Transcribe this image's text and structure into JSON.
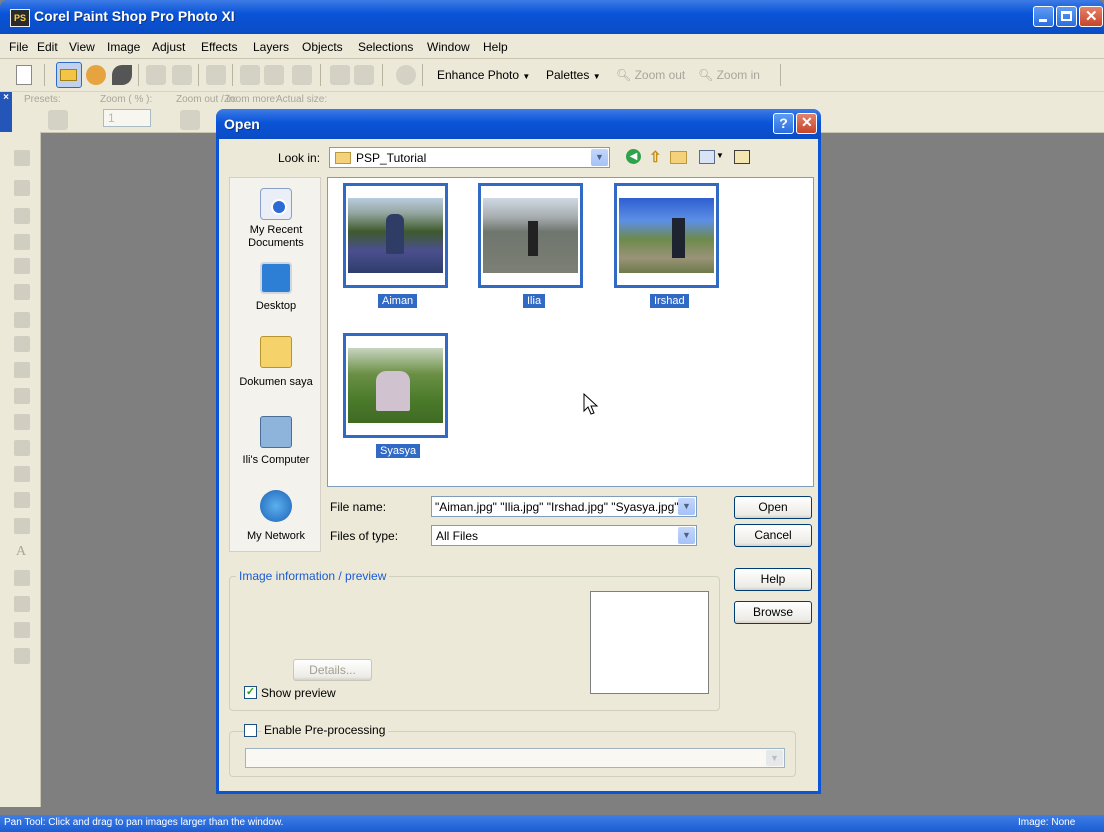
{
  "app": {
    "title": "Corel Paint Shop Pro Photo XI",
    "icon_text": "PS"
  },
  "menu": [
    "File",
    "Edit",
    "View",
    "Image",
    "Adjust",
    "Effects",
    "Layers",
    "Objects",
    "Selections",
    "Window",
    "Help"
  ],
  "toolbar": {
    "enhance_photo": "Enhance Photo",
    "palettes": "Palettes",
    "zoom_out": "Zoom out",
    "zoom_in": "Zoom in"
  },
  "tool_options": {
    "presets": "Presets:",
    "zoom_pct": "Zoom ( % ):",
    "zoom_out_in": "Zoom out / in:",
    "zoom_more": "Zoom more:",
    "actual_size": "Actual size:",
    "zoom_value": "1"
  },
  "status": {
    "left": "Pan Tool: Click and drag to pan images larger than the window.",
    "right": "Image: None"
  },
  "dialog": {
    "title": "Open",
    "help_btn": "?",
    "look_in_label": "Look in:",
    "look_in_value": "PSP_Tutorial",
    "places": [
      {
        "label": "My Recent Documents",
        "icon": "recent-documents-icon"
      },
      {
        "label": "Desktop",
        "icon": "desktop-icon"
      },
      {
        "label": "Dokumen saya",
        "icon": "my-documents-icon"
      },
      {
        "label": "Ili's Computer",
        "icon": "my-computer-icon"
      },
      {
        "label": "My Network",
        "icon": "my-network-icon"
      }
    ],
    "files": [
      {
        "name": "Aiman"
      },
      {
        "name": "Ilia"
      },
      {
        "name": "Irshad"
      },
      {
        "name": "Syasya"
      }
    ],
    "file_name_label": "File name:",
    "file_name_value": "\"Aiman.jpg\" \"Ilia.jpg\" \"Irshad.jpg\" \"Syasya.jpg\"",
    "files_of_type_label": "Files of type:",
    "files_of_type_value": "All Files",
    "open_btn": "Open",
    "cancel_btn": "Cancel",
    "help_button": "Help",
    "browse_btn": "Browse",
    "image_info_label": "Image information / preview",
    "details_btn": "Details...",
    "show_preview": {
      "label": "Show preview",
      "checked": true
    },
    "enable_preprocessing": {
      "label": "Enable Pre-processing",
      "checked": false
    }
  },
  "colors": {
    "xp_blue": "#0a54d8",
    "selection": "#316ac5",
    "face": "#ece9d8"
  }
}
